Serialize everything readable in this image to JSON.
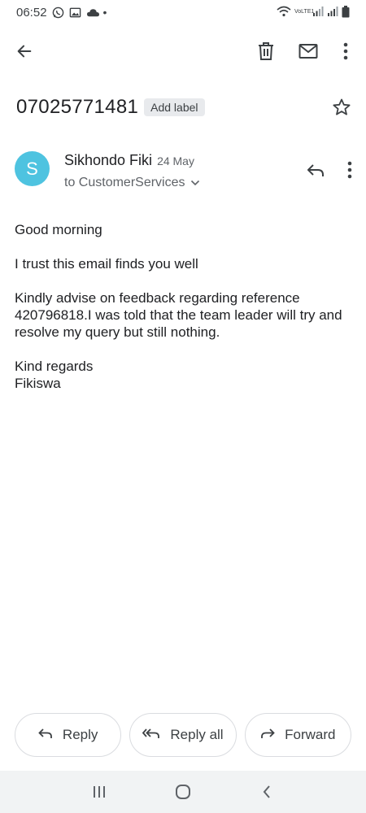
{
  "status_bar": {
    "time": "06:52",
    "left_icons": [
      "whatsapp-icon",
      "image-icon",
      "cloud-icon",
      "dot-icon"
    ],
    "right_icons": [
      "wifi-icon",
      "volte-icon",
      "signal-icon",
      "signal-icon",
      "battery-icon"
    ],
    "volte_text": "VoLTE1"
  },
  "toolbar": {
    "back": "back-arrow-icon",
    "delete": "trash-icon",
    "mark_unread": "mail-icon",
    "more": "more-vert-icon"
  },
  "email": {
    "subject": "07025771481",
    "label_chip": "Add label",
    "sender": {
      "initial": "S",
      "name": "Sikhondo Fiki",
      "date": "24 May",
      "recipient": "to CustomerServices",
      "avatar_color": "#4ec3e0"
    },
    "body": {
      "greeting": "Good morning",
      "line1": "I trust this email finds you well",
      "line2": "Kindly advise on feedback regarding reference 420796818.I was told that the team leader will try and resolve my query but still nothing.",
      "closing": "Kind regards",
      "signature": "Fikiswa"
    }
  },
  "actions": {
    "reply": "Reply",
    "reply_all": "Reply all",
    "forward": "Forward"
  },
  "nav": {
    "recents": "recents-icon",
    "home": "home-icon",
    "back": "back-chevron-icon"
  }
}
